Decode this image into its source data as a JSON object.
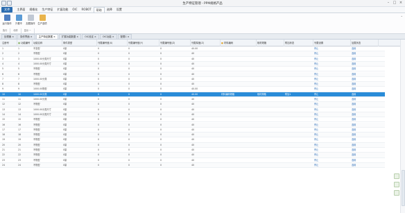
{
  "title_bar": {
    "title": "生产特征管理 - PPM规格产品"
  },
  "window_controls": {
    "minimize": "–",
    "restore": "□",
    "close": "×"
  },
  "menu": {
    "file_label": "文件",
    "items": [
      "主界面",
      "规格化",
      "生产特征",
      "扩展功能",
      "OIC",
      "ROBOT",
      "帮助",
      "选择",
      "设置"
    ],
    "active_index": 6
  },
  "ribbon": {
    "buttons": [
      {
        "label": "运行操作",
        "icon": "run-icon",
        "color": "#4f7fc2"
      },
      {
        "label": "只看不",
        "icon": "view-icon",
        "color": "#5b9bd5"
      },
      {
        "label": "加载操作",
        "icon": "load-icon",
        "color": "#c0c8d4"
      },
      {
        "label": "生产选项",
        "icon": "produce-icon",
        "color": "#e9b44c"
      }
    ],
    "groups": [
      "执行",
      "动作",
      "显示 ~"
    ]
  },
  "doc_tabs": [
    "处理器",
    "操作界面",
    "主产特征数据",
    "扩展功能数据",
    "OIC设定",
    "OIC功能",
    "配置1"
  ],
  "active_doc_tab": 2,
  "columns": [
    "注册号",
    "功能编号",
    "功能名称",
    "带件类型",
    "刊载编号值(X)",
    "刊载编号值(Y)",
    "刊载编号值(Z)",
    "刊载厚度(Z)",
    "材料编码",
    "相材规格",
    "附加状态",
    "刊载设置",
    "加载状态"
  ],
  "column_icon": "table-icon",
  "material_icon": "warning-icon",
  "rows": [
    [
      "1",
      "1",
      "不变型",
      "0量",
      "0",
      "0",
      "0",
      "40.00",
      "",
      "",
      "",
      "停止",
      "选用"
    ],
    [
      "2",
      "2",
      "不规型",
      "0量",
      "0",
      "0",
      "0",
      "40",
      "",
      "",
      "",
      "停止",
      "选用"
    ],
    [
      "3",
      "3",
      "1000.00分类尺寸",
      "0量",
      "0",
      "0",
      "0",
      "40",
      "",
      "",
      "",
      "停止",
      "选用"
    ],
    [
      "4",
      "4",
      "1000.00分类尺寸",
      "0量",
      "0",
      "0",
      "0",
      "40",
      "",
      "",
      "",
      "停止",
      "选用"
    ],
    [
      "5",
      "5",
      "不规型",
      "0量",
      "0",
      "0",
      "0",
      "40",
      "",
      "",
      "",
      "停止",
      "选用"
    ],
    [
      "6",
      "6",
      "不规型",
      "0量",
      "0",
      "0",
      "0",
      "40",
      "",
      "",
      "",
      "停止",
      "选用"
    ],
    [
      "7",
      "7",
      "1000.00分类",
      "0量",
      "0",
      "0",
      "0",
      "40",
      "",
      "",
      "",
      "停止",
      "选用"
    ],
    [
      "8",
      "8",
      "不规型",
      "0量",
      "0",
      "0",
      "0",
      "40",
      "",
      "",
      "",
      "停止",
      "选用"
    ],
    [
      "9",
      "9",
      "1000.00规型",
      "0量",
      "0",
      "0",
      "0",
      "40.00",
      "",
      "",
      "",
      "停止",
      "选用"
    ],
    [
      "10",
      "10",
      "1000.00分类",
      "0量",
      "0",
      "0",
      "0",
      "40.00",
      "材料编码规格",
      "相材规格",
      "附加1",
      "停止",
      "选用"
    ],
    [
      "11",
      "11",
      "1000.00分类",
      "0量",
      "0",
      "0",
      "0",
      "40",
      "",
      "",
      "",
      "停止",
      "选用"
    ],
    [
      "12",
      "12",
      "不规型",
      "0量",
      "0",
      "0",
      "0",
      "40",
      "",
      "",
      "",
      "停止",
      "选用"
    ],
    [
      "13",
      "13",
      "1000.00分类尺寸",
      "0量",
      "0",
      "0",
      "0",
      "40",
      "",
      "",
      "",
      "停止",
      "选用"
    ],
    [
      "14",
      "14",
      "1000.00分类尺寸",
      "0量",
      "0",
      "0",
      "0",
      "40",
      "",
      "",
      "",
      "停止",
      "选用"
    ],
    [
      "15",
      "15",
      "不规型",
      "0量",
      "0",
      "0",
      "0",
      "40",
      "",
      "",
      "",
      "停止",
      "选用"
    ],
    [
      "16",
      "16",
      "不规型",
      "0量",
      "0",
      "0",
      "0",
      "40",
      "",
      "",
      "",
      "停止",
      "选用"
    ],
    [
      "17",
      "17",
      "不规型",
      "0量",
      "0",
      "0",
      "0",
      "40",
      "",
      "",
      "",
      "停止",
      "选用"
    ],
    [
      "18",
      "18",
      "不规型",
      "0量",
      "0",
      "0",
      "0",
      "40",
      "",
      "",
      "",
      "停止",
      "选用"
    ],
    [
      "19",
      "19",
      "不规型",
      "0量",
      "0",
      "0",
      "0",
      "40",
      "",
      "",
      "",
      "停止",
      "选用"
    ],
    [
      "20",
      "20",
      "不规型",
      "0量",
      "0",
      "0",
      "0",
      "40",
      "",
      "",
      "",
      "停止",
      "选用"
    ],
    [
      "21",
      "21",
      "不规型",
      "0量",
      "0",
      "0",
      "0",
      "40",
      "",
      "",
      "",
      "停止",
      "选用"
    ],
    [
      "22",
      "22",
      "不规型",
      "0量",
      "0",
      "0",
      "0",
      "40",
      "",
      "",
      "",
      "停止",
      "选用"
    ],
    [
      "23",
      "23",
      "不规型",
      "0量",
      "0",
      "0",
      "0",
      "40",
      "",
      "",
      "",
      "停止",
      "选用"
    ],
    [
      "24",
      "24",
      "不规型",
      "0量",
      "0",
      "0",
      "0",
      "40",
      "",
      "",
      "",
      "停止",
      "选用"
    ]
  ],
  "selected_row_index": 9,
  "colors": {
    "accent": "#2b6cb0",
    "selection": "#2a8cd8",
    "link": "#2e6fb8"
  },
  "side_tools": [
    "expand-icon",
    "filter-icon",
    "settings-icon"
  ]
}
